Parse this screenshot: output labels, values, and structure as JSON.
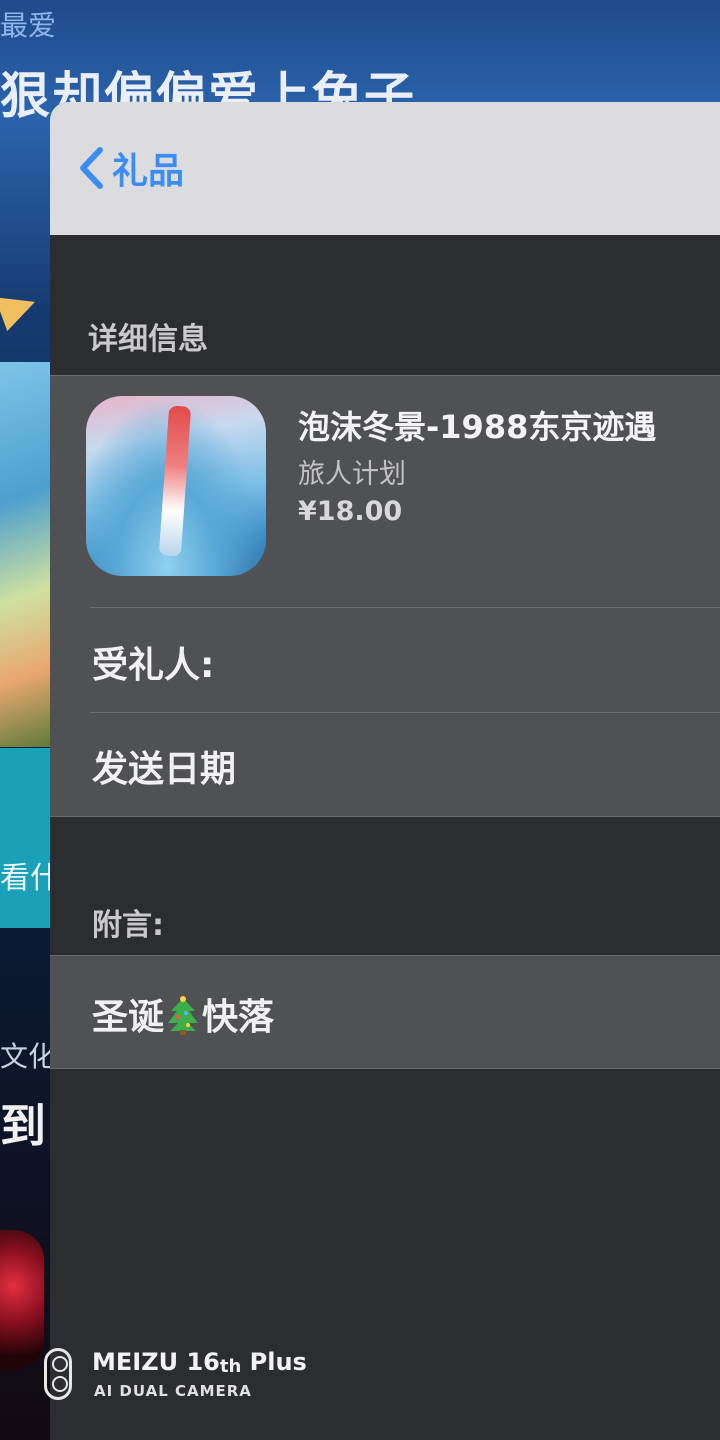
{
  "background_page": {
    "top_label": "最爱",
    "title": "狠却偏偏爱上兔子",
    "watch_text": "看什",
    "culture_text": "文化",
    "bottom_text": "到:"
  },
  "nav": {
    "back_label": "礼品",
    "accent_color": "#3a8df2"
  },
  "details": {
    "section_title": "详细信息",
    "app": {
      "name": "泡沫冬景-1988东京迹遇",
      "developer": "旅人计划",
      "price": "¥18.00"
    },
    "recipient_label": "受礼人:",
    "send_date_label": "发送日期"
  },
  "message": {
    "section_title": "附言:",
    "text_before": "圣诞",
    "emoji_icon": "christmas-tree-icon",
    "text_after": "快落"
  },
  "watermark": {
    "brand": "MEIZU 16",
    "brand_suffix": "th",
    "brand_model": "Plus",
    "subtitle": "AI DUAL CAMERA"
  }
}
